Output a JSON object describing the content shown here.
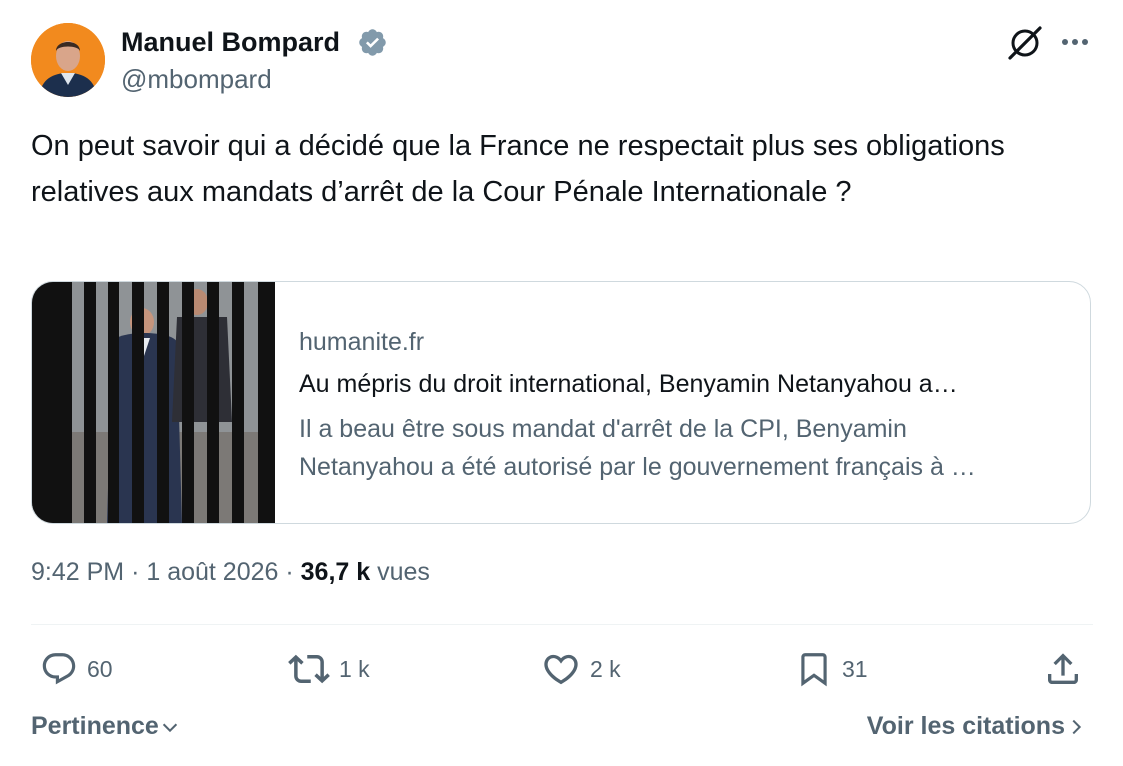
{
  "author": {
    "display_name": "Manuel Bompard",
    "handle": "@mbompard",
    "verified": true,
    "avatar_bg": "#f28a1e"
  },
  "header_icons": [
    "grok-icon",
    "more-icon"
  ],
  "tweet": {
    "text": "On peut savoir qui a décidé que la France ne respectait plus ses obligations relatives aux mandats d’arrêt de la Cour Pénale Internationale ?"
  },
  "card": {
    "domain": "humanite.fr",
    "title": "Au mépris du droit international, Benyamin Netanyahou a…",
    "description_line1": "Il a beau être sous mandat d'arrêt de la CPI, Benyamin",
    "description_line2": "Netanyahou a été autorisé par le gouvernement français à …"
  },
  "meta": {
    "time": "9:42 PM",
    "separator": "·",
    "date": "1 août 2026",
    "views_count": "36,7 k",
    "views_label": "vues"
  },
  "actions": {
    "replies": "60",
    "reposts": "1 k",
    "likes": "2 k",
    "bookmarks": "31"
  },
  "footer": {
    "sort_label": "Pertinence",
    "quotes_label": "Voir les citations"
  },
  "colors": {
    "text": "#0f1419",
    "secondary": "#536471",
    "border": "#cfd9de",
    "verified": "#829aab"
  }
}
